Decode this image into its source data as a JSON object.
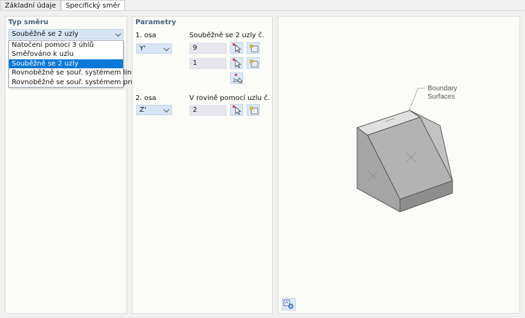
{
  "tabs": [
    {
      "label": "Základní údaje",
      "active": false
    },
    {
      "label": "Specifický směr",
      "active": true
    }
  ],
  "left": {
    "title": "Typ směru",
    "selected": "Souběžně se 2 uzly",
    "options": [
      "Natočení pomocí 3 úhlů",
      "Směřováno k uzlu",
      "Souběžně se 2 uzly",
      "Rovnoběžně se souř. systémem linie",
      "Rovnoběžně se souř. systémem prutu"
    ]
  },
  "params": {
    "title": "Parametry",
    "axis1": {
      "label": "1. osa",
      "value": "Y'",
      "header": "Souběžně se 2 uzly č.",
      "node1": "9",
      "node2": "1"
    },
    "axis2": {
      "label": "2. osa",
      "value": "Z'",
      "header": "V rovině pomocí uzlu č.",
      "node": "2"
    }
  },
  "viewer": {
    "label_line1": "Boundary",
    "label_line2": "Surfaces"
  },
  "colors": {
    "accent": "#0a78d7",
    "dropdown": "#d8e5f5",
    "input": "#e6e6ee",
    "title": "#4b5f8a"
  }
}
